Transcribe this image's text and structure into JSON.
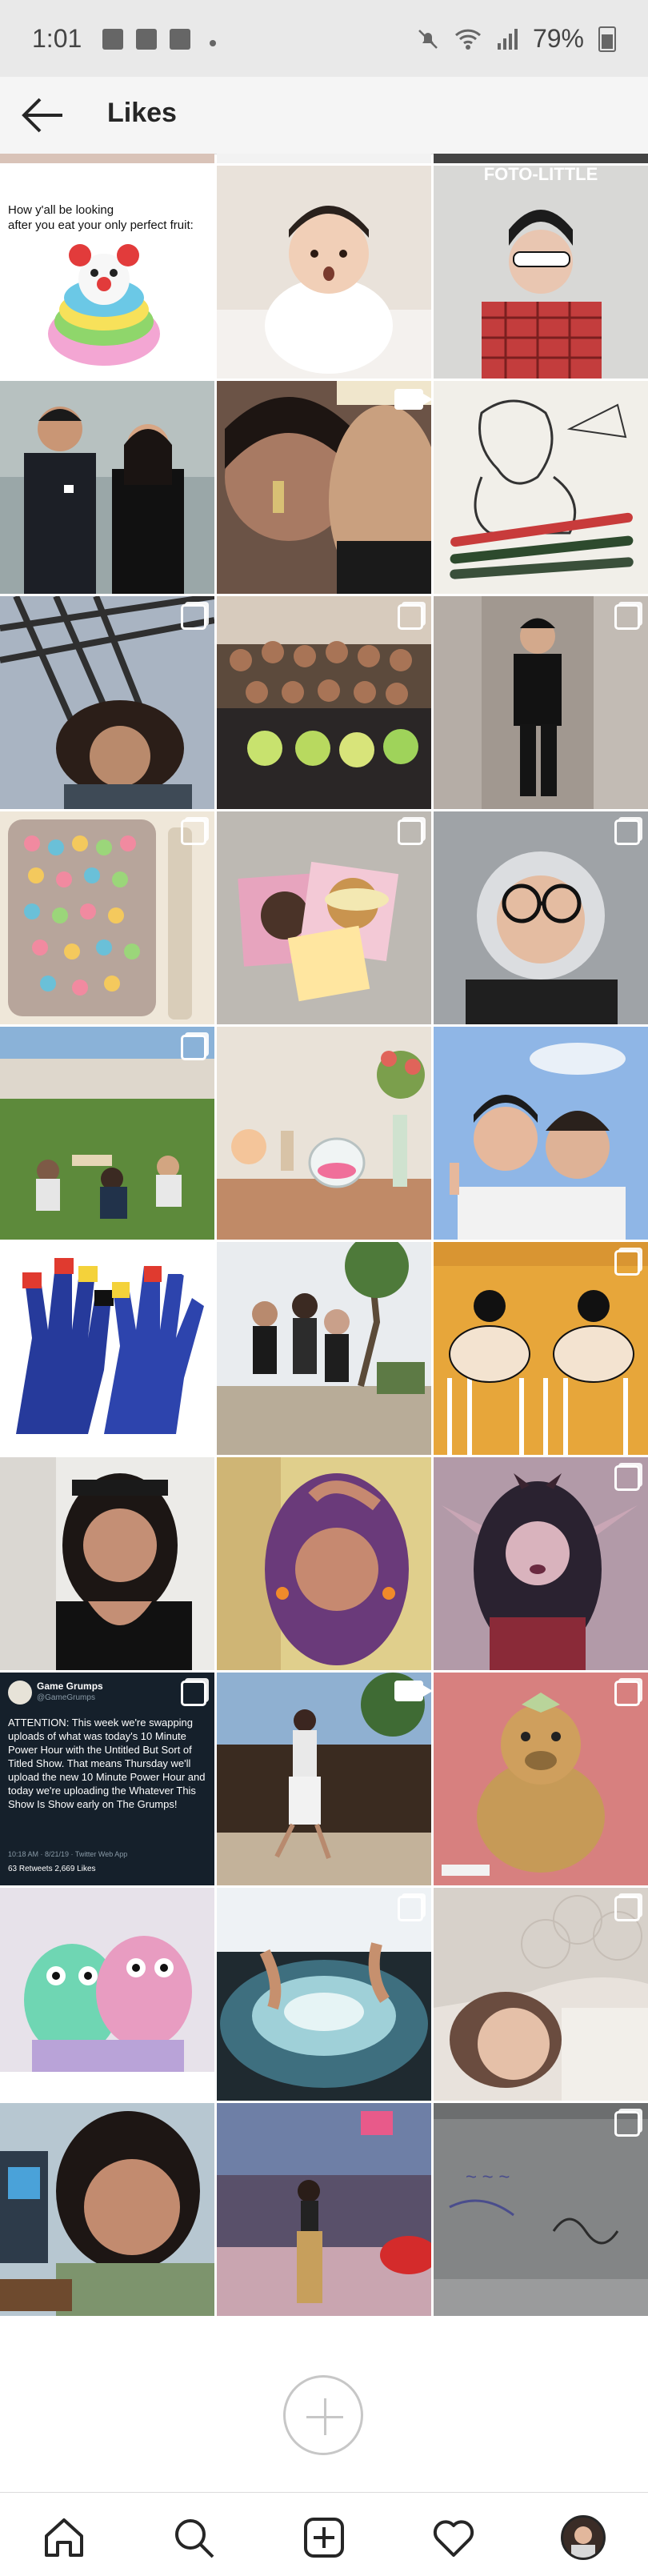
{
  "status_bar": {
    "time": "1:01",
    "battery": "79%"
  },
  "header": {
    "title": "Likes",
    "back_icon": "arrow-left-icon"
  },
  "posts": [
    {
      "id": "meme",
      "caption": "How y'all be looking\nafter you eat your only perfect fruit:"
    },
    {
      "id": "baby"
    },
    {
      "id": "magazine",
      "masthead": "FOTO-LITTLE"
    },
    {
      "id": "couple"
    },
    {
      "id": "lipstick",
      "type": "video"
    },
    {
      "id": "drawing"
    },
    {
      "id": "windy",
      "type": "carousel"
    },
    {
      "id": "group",
      "type": "carousel"
    },
    {
      "id": "mirror",
      "type": "carousel"
    },
    {
      "id": "phone-case",
      "type": "carousel"
    },
    {
      "id": "cards",
      "type": "carousel"
    },
    {
      "id": "glasses",
      "type": "carousel"
    },
    {
      "id": "park",
      "type": "carousel"
    },
    {
      "id": "still-life"
    },
    {
      "id": "peace"
    },
    {
      "id": "gloves",
      "type": "carousel"
    },
    {
      "id": "friends"
    },
    {
      "id": "socks",
      "type": "carousel"
    },
    {
      "id": "portrait"
    },
    {
      "id": "purple-hair"
    },
    {
      "id": "elf-art",
      "type": "carousel"
    },
    {
      "id": "tweet",
      "type": "carousel",
      "tweet": {
        "name": "Game Grumps",
        "handle": "@GameGrumps",
        "text": "ATTENTION: This week we're swapping uploads of what was today's 10 Minute Power Hour with the Untitled But Sort of Titled Show. That means Thursday we'll upload the new 10 Minute Power Hour and today we're uploading the Whatever This Show Is Show early on The Grumps!",
        "meta": "10:18 AM · 8/21/19 · Twitter Web App",
        "stats": "63 Retweets   2,669 Likes"
      }
    },
    {
      "id": "dance",
      "type": "video"
    },
    {
      "id": "plush",
      "type": "carousel"
    },
    {
      "id": "monsters"
    },
    {
      "id": "water",
      "type": "carousel"
    },
    {
      "id": "bed",
      "type": "carousel"
    },
    {
      "id": "selfie"
    },
    {
      "id": "street"
    },
    {
      "id": "wall",
      "type": "carousel"
    }
  ],
  "bottom_nav": {
    "items": [
      "home-icon",
      "search-icon",
      "new-post-icon",
      "activity-heart-icon",
      "profile-avatar"
    ]
  },
  "colors": {
    "accent": "#262626",
    "tweet_bg": "#15202b"
  }
}
